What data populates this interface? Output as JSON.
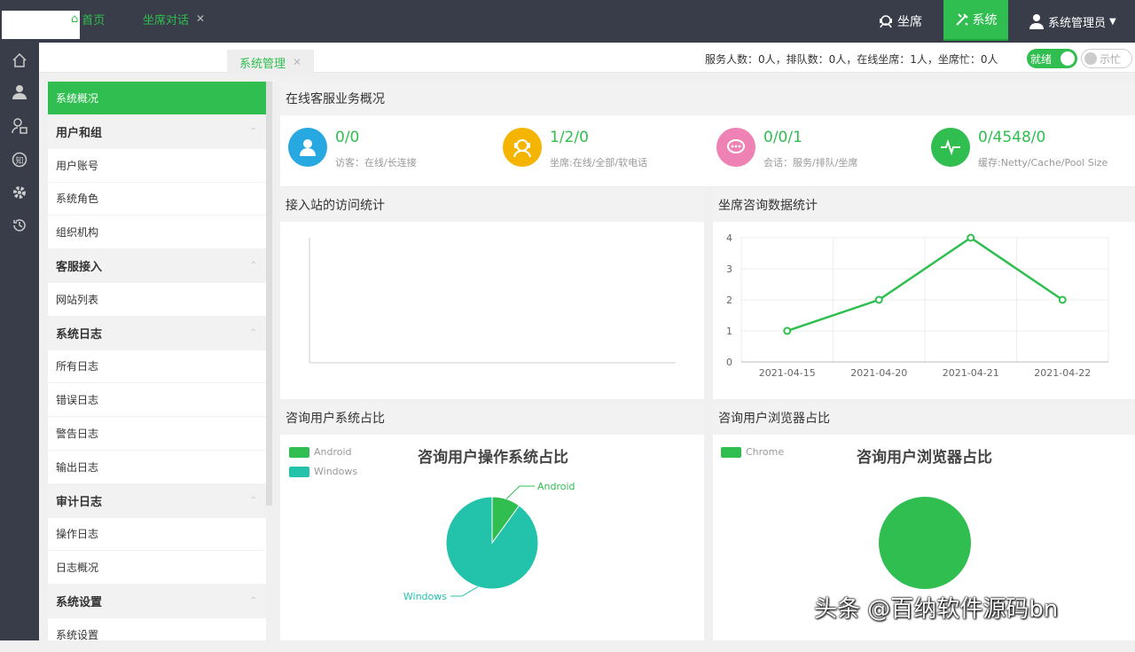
{
  "header": {
    "seat_label": "坐席",
    "system_label": "系统",
    "user_label": "系统管理员"
  },
  "tabs": [
    {
      "label": "首页"
    },
    {
      "label": "坐席对话"
    },
    {
      "label": "系统管理"
    }
  ],
  "status": {
    "text": "服务人数：0人，排队数：0人，在线坐席：1人，坐席忙：0人",
    "ready_label": "就绪",
    "busy_label": "示忙"
  },
  "menu": {
    "items": [
      {
        "label": "系统概况",
        "type": "active"
      },
      {
        "label": "用户和组",
        "type": "group"
      },
      {
        "label": "用户账号",
        "type": "item"
      },
      {
        "label": "系统角色",
        "type": "item"
      },
      {
        "label": "组织机构",
        "type": "item"
      },
      {
        "label": "客服接入",
        "type": "group"
      },
      {
        "label": "网站列表",
        "type": "item"
      },
      {
        "label": "系统日志",
        "type": "group"
      },
      {
        "label": "所有日志",
        "type": "item"
      },
      {
        "label": "错误日志",
        "type": "item"
      },
      {
        "label": "警告日志",
        "type": "item"
      },
      {
        "label": "输出日志",
        "type": "item"
      },
      {
        "label": "审计日志",
        "type": "group"
      },
      {
        "label": "操作日志",
        "type": "item"
      },
      {
        "label": "日志概况",
        "type": "item"
      },
      {
        "label": "系统设置",
        "type": "group"
      },
      {
        "label": "系统设置",
        "type": "item"
      }
    ]
  },
  "overview": {
    "title": "在线客服业务概况",
    "stats": [
      {
        "value": "0/0",
        "label": "访客：在线/长连接",
        "color": "#28a8e0"
      },
      {
        "value": "1/2/0",
        "label": "坐席:在线/全部/软电话",
        "color": "#f5b400"
      },
      {
        "value": "0/0/1",
        "label": "会话：服务/排队/坐席",
        "color": "#ee82b4"
      },
      {
        "value": "0/4548/0",
        "label": "缓存:Netty/Cache/Pool Size",
        "color": "#2fbe4f"
      }
    ]
  },
  "panels": {
    "visit_title": "接入站的访问统计",
    "consult_title": "坐席咨询数据统计",
    "os_title": "咨询用户系统占比",
    "browser_title": "咨询用户浏览器占比"
  },
  "chart_data": [
    {
      "type": "line",
      "title": "",
      "categories": [
        "2021-04-15",
        "2021-04-20",
        "2021-04-21",
        "2021-04-22"
      ],
      "series": [
        {
          "values": [
            1,
            2,
            4,
            2
          ]
        }
      ],
      "y_ticks": [
        "0",
        "1",
        "2",
        "3",
        "4"
      ],
      "ylim": [
        0,
        4
      ],
      "grid": true,
      "color": "#2fbe4f"
    },
    {
      "type": "pie",
      "title": "咨询用户操作系统占比",
      "labels": [
        "Android",
        "Windows"
      ],
      "values": [
        10,
        90
      ],
      "colors": [
        "#2fbe4f",
        "#22c3aa"
      ],
      "legend": "top-left"
    },
    {
      "type": "pie",
      "title": "咨询用户浏览器占比",
      "labels": [
        "Chrome"
      ],
      "values": [
        100
      ],
      "colors": [
        "#2fbe4f"
      ],
      "legend": "top-left"
    }
  ],
  "watermark": "头条 @百纳软件源码bn"
}
